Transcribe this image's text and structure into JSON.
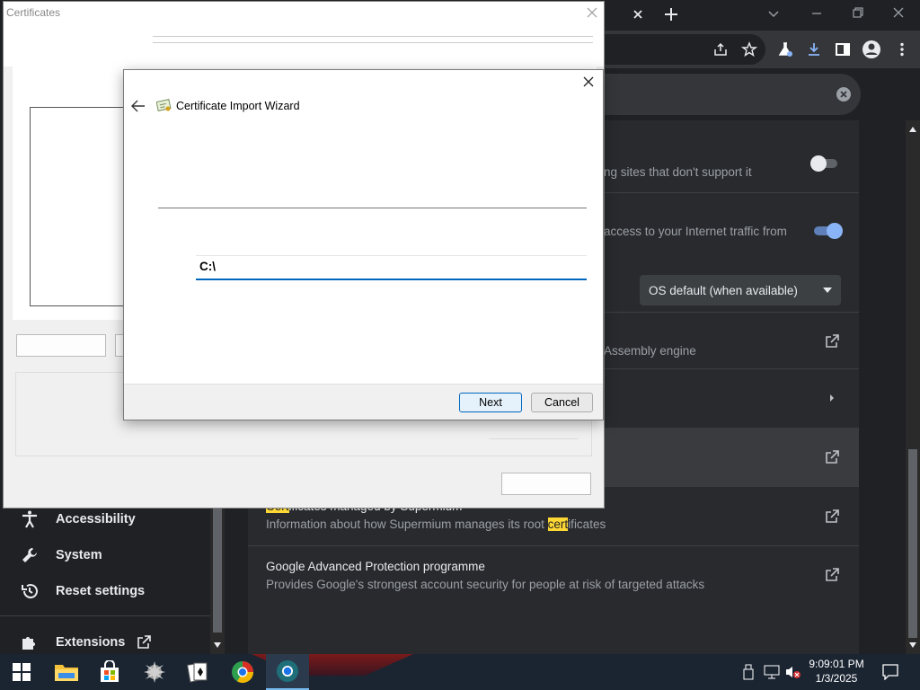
{
  "browser": {
    "settings_rows": [
      {
        "desc": "ng sites that don't support it",
        "toggle": "off"
      },
      {
        "desc": "access to your Internet traffic from",
        "toggle": "on"
      },
      {
        "select_value": "OS default (when available)"
      },
      {
        "desc": "Assembly engine"
      },
      {
        "title": "Certificates managed by Supermium",
        "desc_before": "Information about how Supermium manages its root ",
        "desc_hl": "cert",
        "desc_after": "ificates",
        "title_hl": "Cert",
        "title_rest": "ificates managed by Supermium"
      },
      {
        "title": "Google Advanced Protection programme",
        "desc": "Provides Google's strongest account security for people at risk of targeted attacks"
      }
    ],
    "sidebar": [
      {
        "label": "Accessibility",
        "icon": "accessibility-icon"
      },
      {
        "label": "System",
        "icon": "wrench-icon"
      },
      {
        "label": "Reset settings",
        "icon": "history-icon"
      },
      {
        "label": "Extensions",
        "icon": "puzzle-icon"
      }
    ]
  },
  "cert_window": {
    "title": "Certificates"
  },
  "wizard": {
    "title": "Certificate Import Wizard",
    "file_path": "C:\\",
    "next_label": "Next",
    "cancel_label": "Cancel"
  },
  "taskbar": {
    "time": "9:09:01 PM",
    "date": "1/3/2025",
    "apps": [
      "windows-start-icon",
      "file-explorer-icon",
      "store-icon",
      "app-icon",
      "solitaire-icon",
      "supermium-icon",
      "supermium-active-icon"
    ]
  },
  "colors": {
    "accent": "#0067c0",
    "toggle_on": "#8ab4f8",
    "highlight": "#fdd835"
  }
}
